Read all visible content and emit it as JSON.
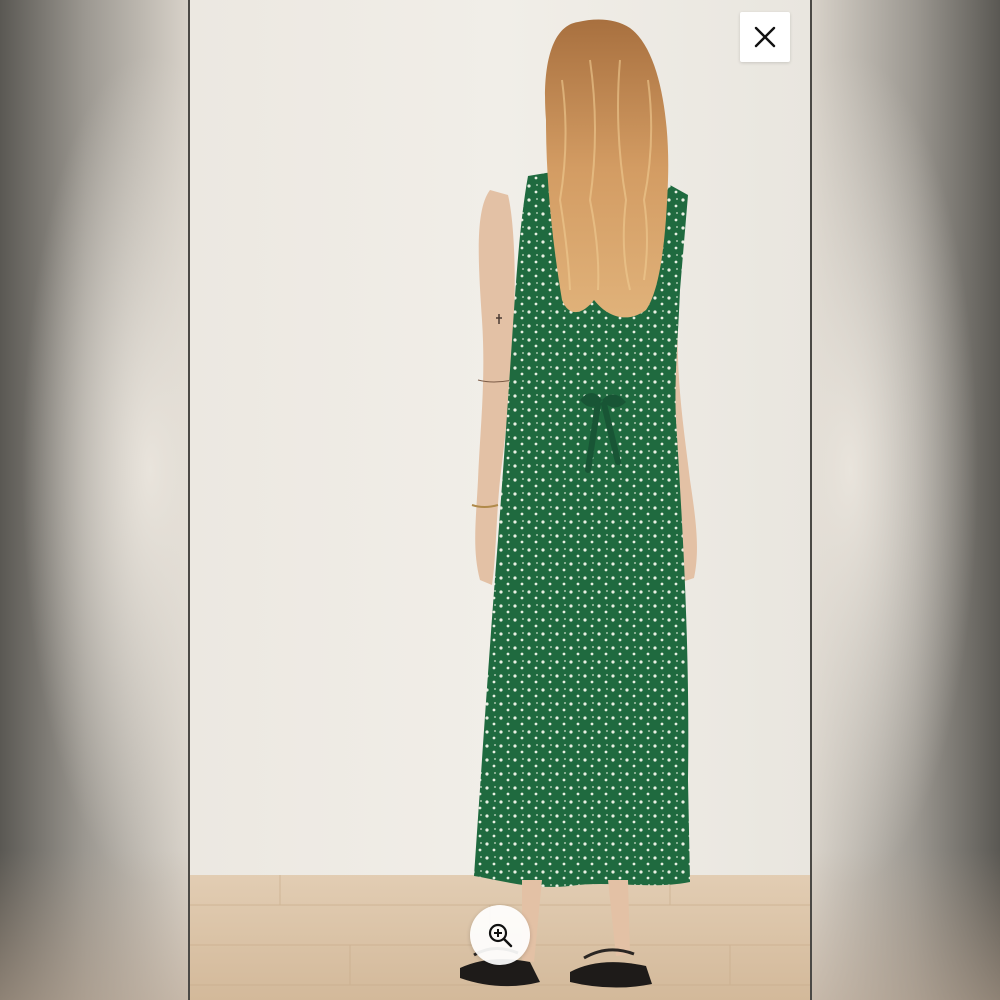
{
  "viewer": {
    "close_icon": "close-icon",
    "zoom_icon": "zoom-in-icon"
  },
  "photo": {
    "subject": "product-photo",
    "colors": {
      "wall": "#efece6",
      "floor": "#d9c2a6",
      "dress": "#1f6a3f",
      "hair": "#c98f5a",
      "skin": "#e7c7ad"
    }
  }
}
